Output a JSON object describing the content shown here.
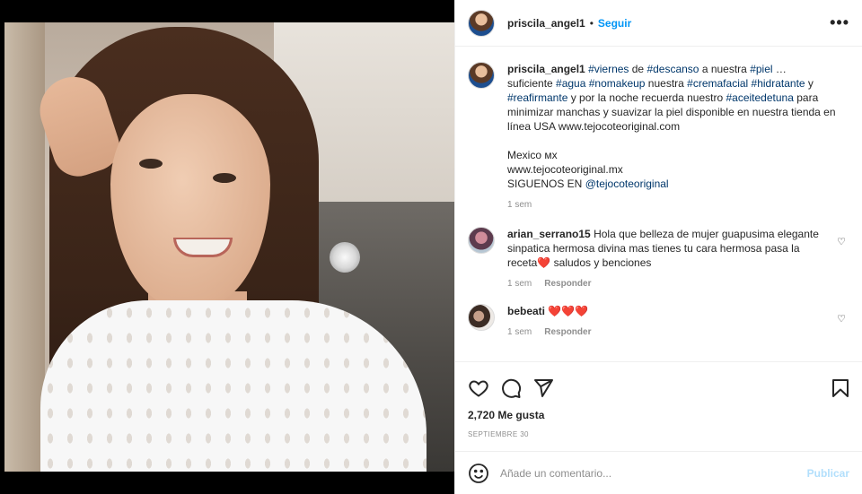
{
  "post": {
    "author": "priscila_angel1",
    "follow_label": "Seguir",
    "separator": "•",
    "more_label": "•••"
  },
  "caption": {
    "author": "priscila_angel1",
    "t1": " ",
    "tag_viernes": "#viernes",
    "t2": " de ",
    "tag_descanso": "#descanso",
    "t3": " a nuestra ",
    "tag_piel": "#piel",
    "t4": " …",
    "t5": "suficiente ",
    "tag_agua": "#agua",
    "t6": " ",
    "tag_nomakeup": "#nomakeup",
    "t7": " nuestra ",
    "tag_cremafacial": "#cremafacial",
    "t8": " ",
    "tag_hidratante": "#hidratante",
    "t9": " y ",
    "tag_reafirmante": "#reafirmante",
    "t10": " y por la noche recuerda nuestro ",
    "tag_aceitedetuna": "#aceitedetuna",
    "t11": " para minimizar manchas y suavizar la piel disponible en nuestra tienda en línea USA www.tejocoteoriginal.com",
    "line_mexico": "Mexico ᴍx",
    "line_url": "www.tejocoteoriginal.mx",
    "line_siguenos": "SIGUENOS EN ",
    "mention": "@tejocoteoriginal",
    "time": "1 sem"
  },
  "comments": [
    {
      "user": "arian_serrano15",
      "text": "Hola que belleza de mujer guapusima elegante sinpatica hermosa divina mas tienes tu cara hermosa pasa la receta",
      "emoji": "❤️",
      "text_after": " saludos y benciones",
      "time": "1 sem",
      "reply_label": "Responder"
    },
    {
      "user": "bebeati",
      "text": "",
      "emoji": "❤️❤️❤️",
      "time": "1 sem",
      "reply_label": "Responder"
    }
  ],
  "likes_text": "2,720 Me gusta",
  "date_text": "SEPTIEMBRE 30",
  "comment_input": {
    "placeholder": "Añade un comentario...",
    "value": ""
  },
  "publish_label": "Publicar",
  "colors": {
    "accent": "#0095f6",
    "hashtag": "#00376b",
    "muted": "#8e8e8e",
    "publish_disabled": "#b2dffc",
    "heart": "#ed4956"
  },
  "icons": {
    "like": "heart-icon",
    "comment": "comment-icon",
    "share": "share-icon",
    "save": "bookmark-icon",
    "emoji": "emoji-icon",
    "more": "more-icon"
  }
}
